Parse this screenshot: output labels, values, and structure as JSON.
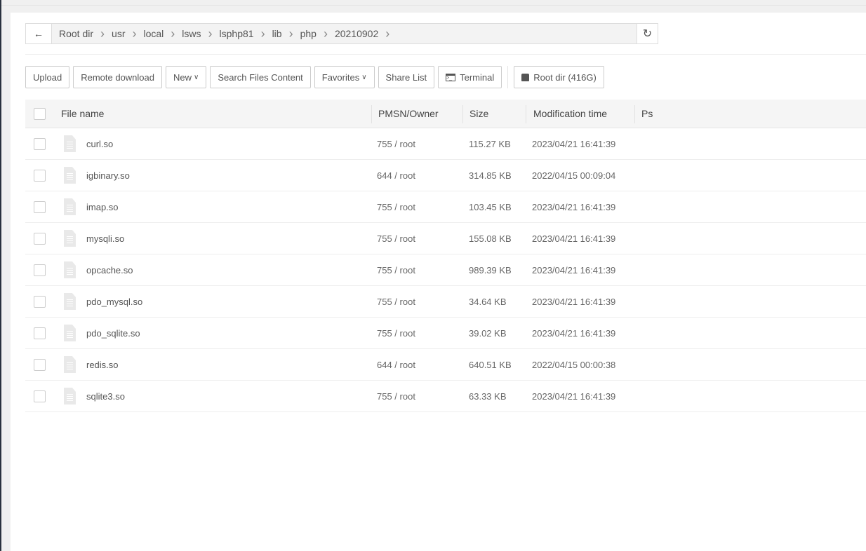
{
  "breadcrumb": [
    "Root dir",
    "usr",
    "local",
    "lsws",
    "lsphp81",
    "lib",
    "php",
    "20210902"
  ],
  "toolbar": {
    "upload": "Upload",
    "remote_download": "Remote download",
    "new": "New",
    "search": "Search Files Content",
    "favorites": "Favorites",
    "share_list": "Share List",
    "terminal": "Terminal",
    "root_dir": "Root dir (416G)"
  },
  "columns": {
    "name": "File name",
    "pmsn": "PMSN/Owner",
    "size": "Size",
    "mtime": "Modification time",
    "ps": "Ps"
  },
  "files": [
    {
      "name": "curl.so",
      "pmsn": "755 / root",
      "size": "115.27 KB",
      "mtime": "2023/04/21 16:41:39"
    },
    {
      "name": "igbinary.so",
      "pmsn": "644 / root",
      "size": "314.85 KB",
      "mtime": "2022/04/15 00:09:04"
    },
    {
      "name": "imap.so",
      "pmsn": "755 / root",
      "size": "103.45 KB",
      "mtime": "2023/04/21 16:41:39"
    },
    {
      "name": "mysqli.so",
      "pmsn": "755 / root",
      "size": "155.08 KB",
      "mtime": "2023/04/21 16:41:39"
    },
    {
      "name": "opcache.so",
      "pmsn": "755 / root",
      "size": "989.39 KB",
      "mtime": "2023/04/21 16:41:39"
    },
    {
      "name": "pdo_mysql.so",
      "pmsn": "755 / root",
      "size": "34.64 KB",
      "mtime": "2023/04/21 16:41:39"
    },
    {
      "name": "pdo_sqlite.so",
      "pmsn": "755 / root",
      "size": "39.02 KB",
      "mtime": "2023/04/21 16:41:39"
    },
    {
      "name": "redis.so",
      "pmsn": "644 / root",
      "size": "640.51 KB",
      "mtime": "2022/04/15 00:00:38"
    },
    {
      "name": "sqlite3.so",
      "pmsn": "755 / root",
      "size": "63.33 KB",
      "mtime": "2023/04/21 16:41:39"
    }
  ]
}
